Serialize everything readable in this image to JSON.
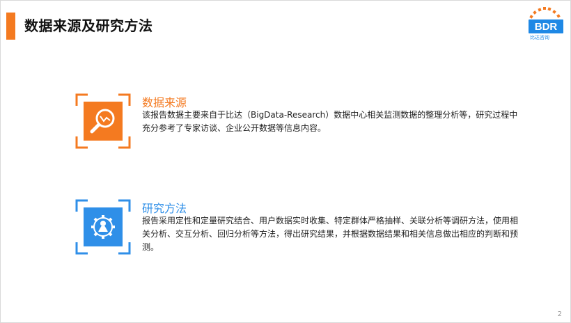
{
  "slide": {
    "title": "数据来源及研究方法",
    "logo": {
      "text": "BDR",
      "subtitle": "比达咨询"
    },
    "page_number": "2"
  },
  "sections": [
    {
      "title": "数据来源",
      "body": "该报告数据主要来自于比达（BigData-Research）数据中心相关监测数据的整理分析等，研究过程中充分参考了专家访谈、企业公开数据等信息内容。",
      "color": "#f47a20",
      "icon": "magnifier-chart-icon"
    },
    {
      "title": "研究方法",
      "body": "报告采用定性和定量研究结合、用户数据实时收集、特定群体严格抽样、关联分析等调研方法，使用相关分析、交互分析、回归分析等方法，得出研究结果，并根据数据结果和相关信息做出相应的判断和预测。",
      "color": "#2f8fe8",
      "icon": "gear-research-icon"
    }
  ]
}
